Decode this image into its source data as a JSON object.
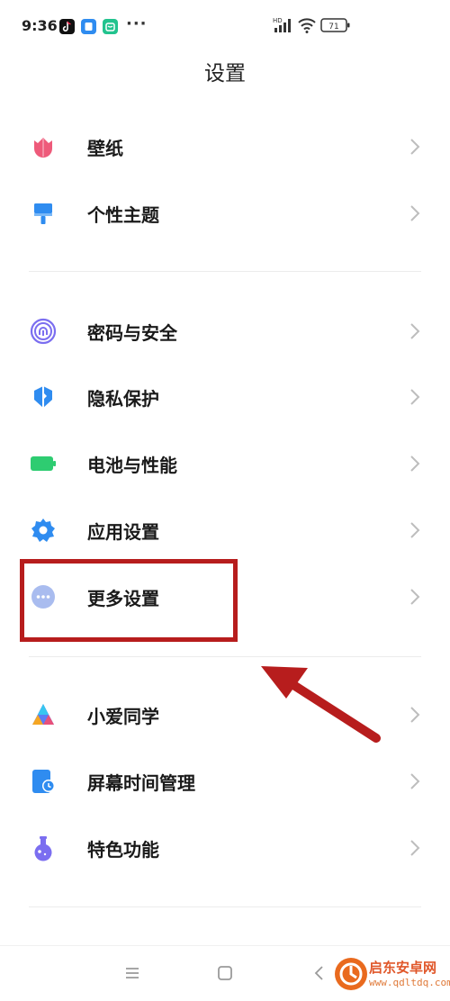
{
  "status_bar": {
    "time": "9:36",
    "more": "···",
    "network": "HD",
    "battery": "71"
  },
  "header": {
    "title": "设置"
  },
  "items": [
    {
      "label": "壁纸",
      "icon": "wallpaper-icon",
      "color": "#ee5a7a"
    },
    {
      "label": "个性主题",
      "icon": "theme-brush-icon",
      "color": "#2f8cf0"
    },
    {
      "label": "密码与安全",
      "icon": "fingerprint-icon",
      "color": "#7b6ef0"
    },
    {
      "label": "隐私保护",
      "icon": "privacy-shield-icon",
      "color": "#2f8cf0"
    },
    {
      "label": "电池与性能",
      "icon": "battery-icon",
      "color": "#2ecc71"
    },
    {
      "label": "应用设置",
      "icon": "gear-icon",
      "color": "#2f8cf0"
    },
    {
      "label": "更多设置",
      "icon": "more-dots-icon",
      "color": "#8ca6e6"
    },
    {
      "label": "小爱同学",
      "icon": "xiaoai-icon",
      "color": "#5b7cf5"
    },
    {
      "label": "屏幕时间管理",
      "icon": "screen-time-icon",
      "color": "#2f8cf0"
    },
    {
      "label": "特色功能",
      "icon": "flask-icon",
      "color": "#7b6ef0"
    }
  ],
  "watermark": {
    "name": "启东安卓网",
    "url": "www.qdltdq.com"
  },
  "colors": {
    "highlight": "#b71d1d",
    "arrow": "#b71d1d"
  }
}
